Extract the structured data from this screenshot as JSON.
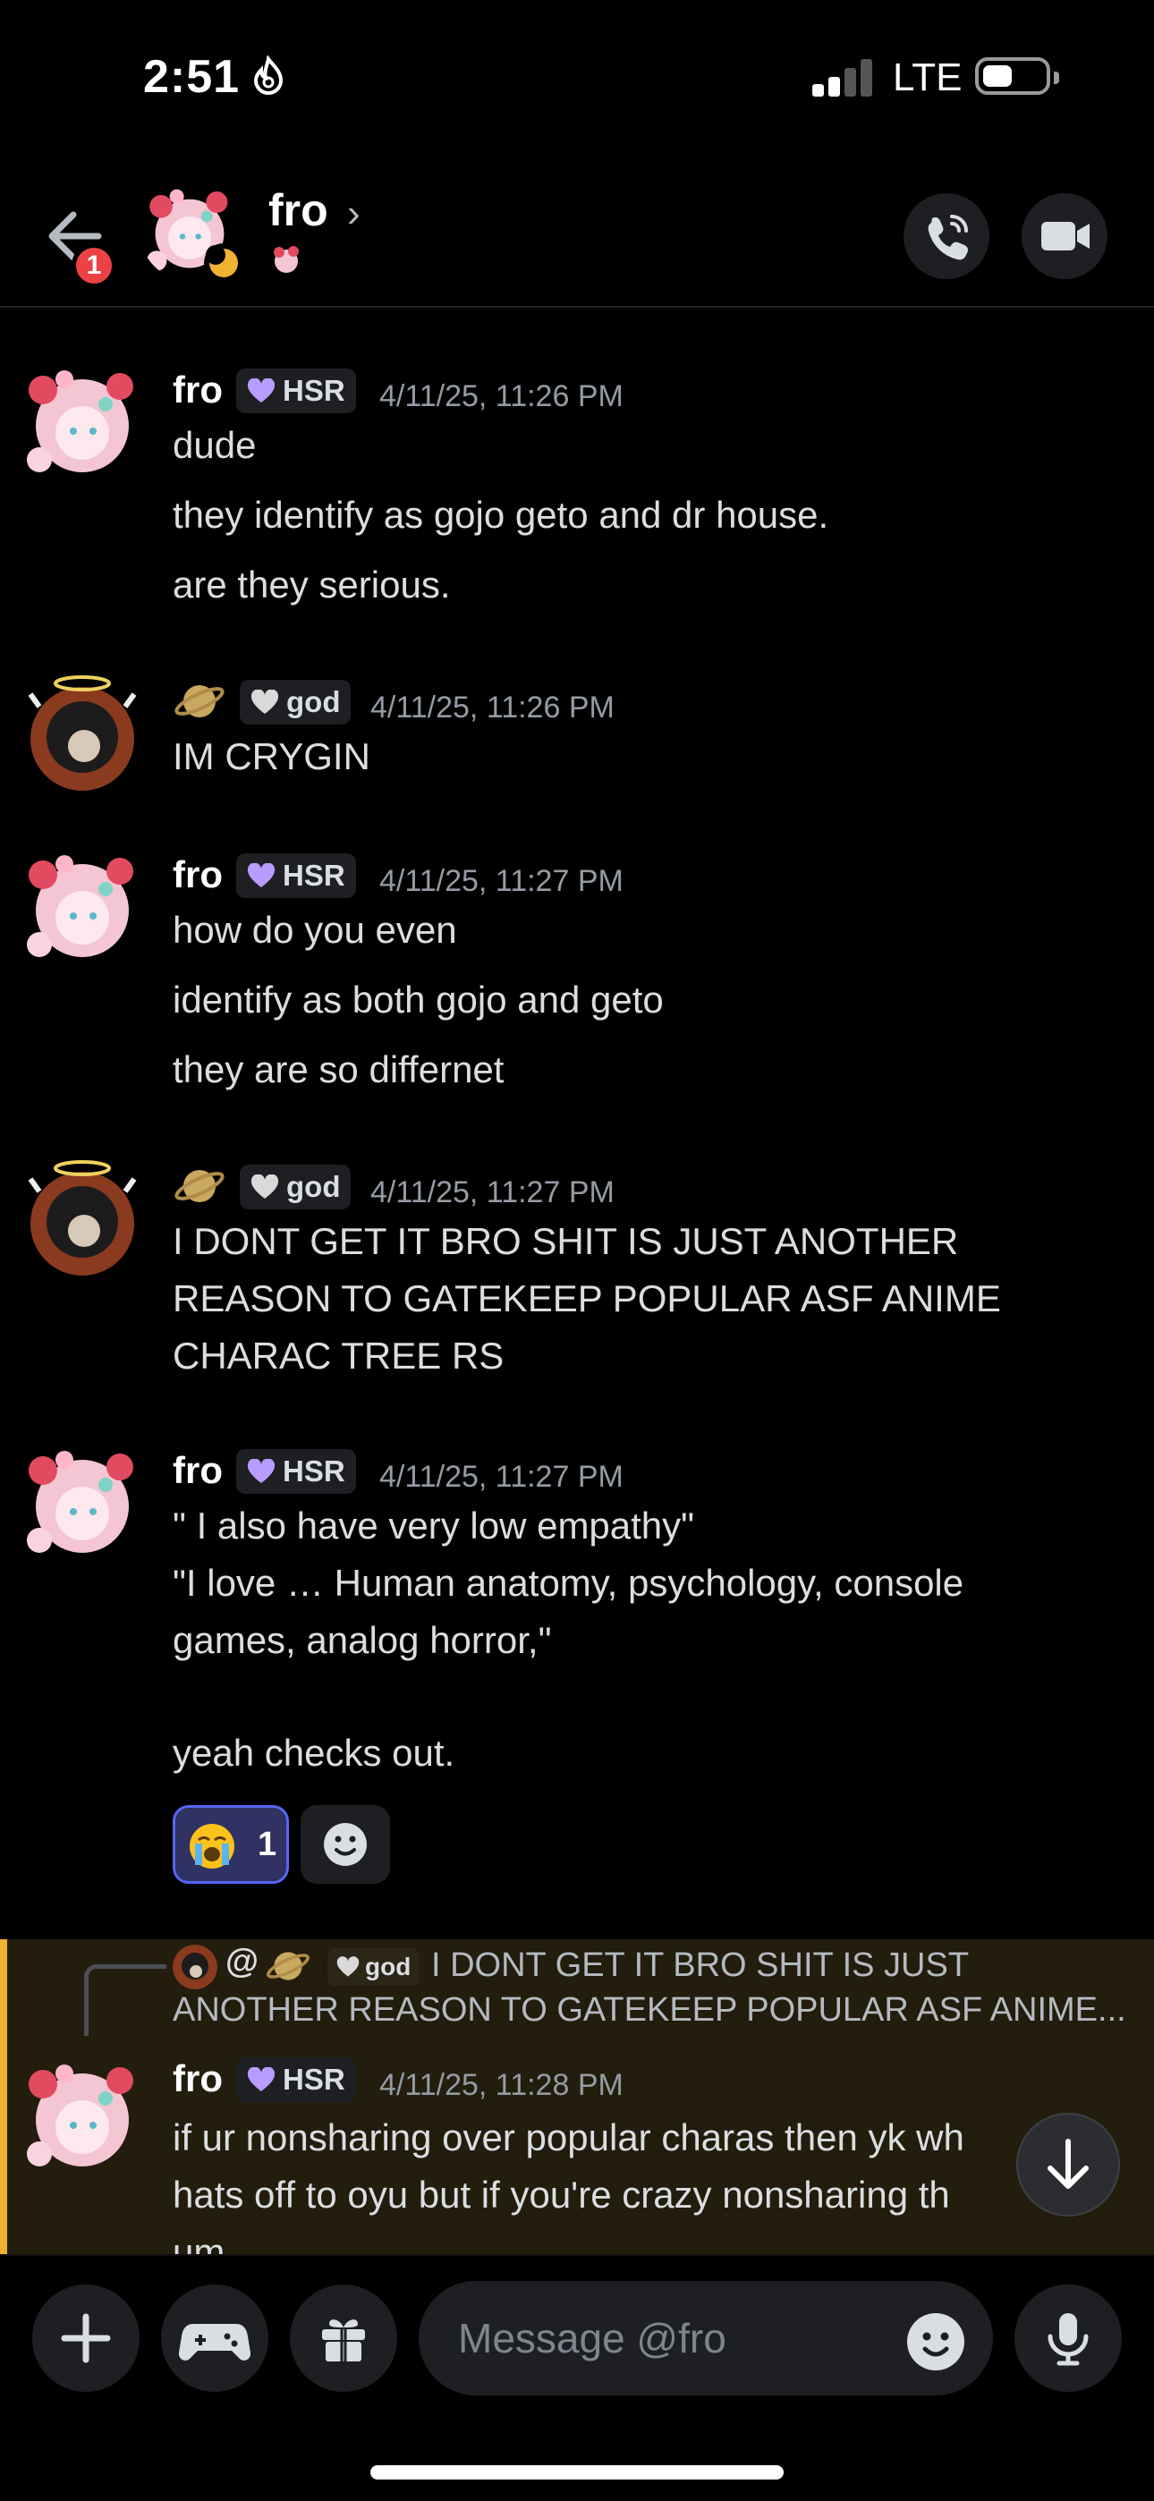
{
  "status_bar": {
    "time": "2:51",
    "network": "LTE"
  },
  "header": {
    "title": "fro",
    "back_badge_count": "1"
  },
  "tags": {
    "hsr": "HSR",
    "god": "god"
  },
  "messages": [
    {
      "author": "fro",
      "tag": "HSR",
      "timestamp": "4/11/25, 11:26 PM",
      "lines": [
        "dude",
        "they identify as gojo geto and dr house.",
        "are they serious."
      ]
    },
    {
      "author": "",
      "tag": "god",
      "timestamp": "4/11/25, 11:26 PM",
      "lines": [
        "IM CRYGIN"
      ]
    },
    {
      "author": "fro",
      "tag": "HSR",
      "timestamp": "4/11/25, 11:27 PM",
      "lines": [
        "how do you even",
        "identify as both gojo and geto",
        "they are so differnet"
      ]
    },
    {
      "author": "",
      "tag": "god",
      "timestamp": "4/11/25, 11:27 PM",
      "lines": [
        "I DONT GET IT BRO SHIT IS JUST ANOTHER",
        "REASON TO GATEKEEP POPULAR ASF ANIME",
        "CHARAC TREE RS"
      ]
    },
    {
      "author": "fro",
      "tag": "HSR",
      "timestamp": "4/11/25, 11:27 PM",
      "lines": [
        "\" I also have very low empathy\"",
        "\"I love … Human anatomy, psychology, console",
        "games, analog horror,\"",
        "yeah checks out."
      ],
      "reaction": {
        "emoji": "loudly-crying-face",
        "count": "1"
      }
    },
    {
      "author": "fro",
      "tag": "HSR",
      "timestamp": "4/11/25, 11:28 PM",
      "reply": {
        "at": "@",
        "tag": "god",
        "line1": "I DONT GET IT BRO SHIT IS JUST",
        "line2": "ANOTHER REASON TO GATEKEEP POPULAR ASF ANIME..."
      },
      "lines": [
        "if ur nonsharing over popular charas then yk wh",
        "hats off to oyu but if you're crazy nonsharing th",
        "um"
      ]
    }
  ],
  "composer": {
    "placeholder": "Message @fro"
  },
  "icons": {
    "back": "arrow-left-icon",
    "call": "phone-call-icon",
    "video": "video-camera-icon",
    "plus": "plus-icon",
    "game": "gamepad-icon",
    "gift": "gift-icon",
    "emoji": "smiley-icon",
    "mic": "microphone-icon",
    "scroll_down": "arrow-down-icon"
  },
  "colors": {
    "accent": "#5865f2",
    "highlight_bar": "#f0b232",
    "badge": "#ed4245",
    "tag_heart_hsr": "#b89cff",
    "tag_heart_god": "#d9d9d9"
  }
}
